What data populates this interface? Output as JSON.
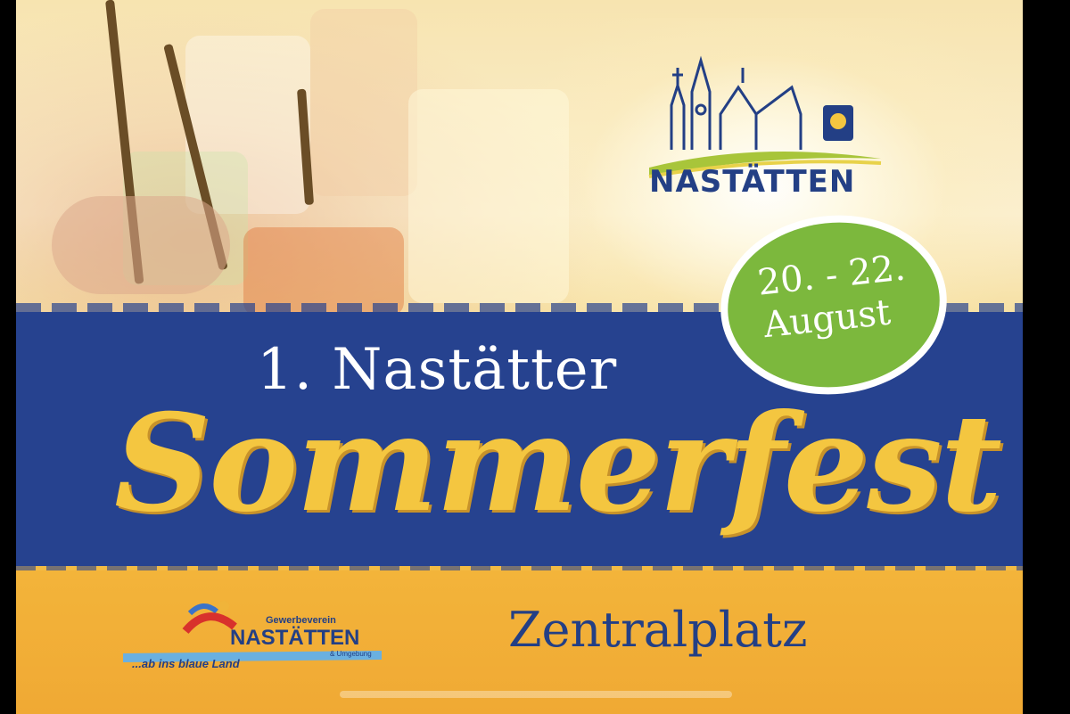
{
  "poster": {
    "headline": "1. Nastätter",
    "title": "Sommerfest",
    "date_line1": "20. - 22.",
    "date_line2": "August",
    "location": "Zentralplatz"
  },
  "town_logo": {
    "name": "NASTÄTTEN",
    "icon": "church-skyline-icon"
  },
  "association_logo": {
    "line1": "Gewerbeverein",
    "line2": "NASTÄTTEN",
    "line3": "& Umgebung",
    "slogan": "...ab ins blaue Land"
  },
  "colors": {
    "blue": "#26428f",
    "yellow": "#f4c640",
    "green": "#7cb83d",
    "orange": "#f0b43a"
  }
}
